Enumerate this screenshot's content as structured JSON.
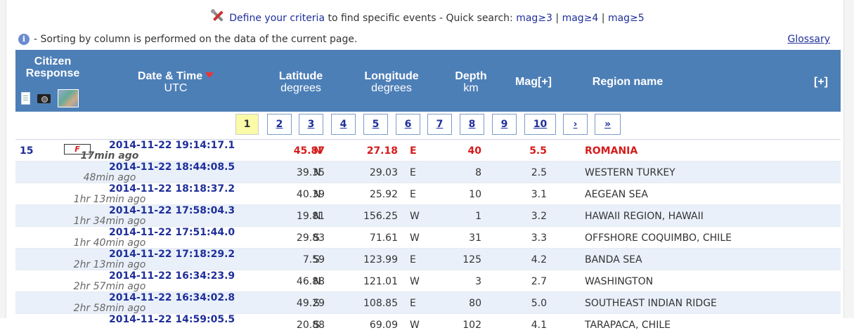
{
  "top": {
    "criteria_link": "Define your criteria",
    "criteria_text": " to find specific events - Quick search: ",
    "quick": [
      "mag≥3",
      "mag≥4",
      "mag≥5"
    ],
    "sep": " | "
  },
  "info": {
    "icon_glyph": "i",
    "text": "- Sorting by column is performed on the data of the current page.",
    "glossary": "Glossary"
  },
  "header": {
    "citizen_line1": "Citizen",
    "citizen_line2": "Response",
    "date_line1": "Date & Time",
    "date_line2": "UTC",
    "lat_line1": "Latitude",
    "lat_line2": "degrees",
    "lon_line1": "Longitude",
    "lon_line2": "degrees",
    "depth_line1": "Depth",
    "depth_line2": "km",
    "mag": "Mag[+]",
    "region": "Region name",
    "more": "[+]"
  },
  "pager": {
    "pages": [
      "1",
      "2",
      "3",
      "4",
      "5",
      "6",
      "7",
      "8",
      "9",
      "10"
    ],
    "next": "›",
    "last": "»",
    "current": "1"
  },
  "rows": [
    {
      "num": "15",
      "flag": "F",
      "date": "2014-11-22   19:14:17.1",
      "ago": "17min ago",
      "lat": "45.87",
      "lat_dir": "N",
      "lon": "27.18",
      "lon_dir": "E",
      "depth": "40",
      "mag": "5.5",
      "region": "ROMANIA",
      "highlight": true
    },
    {
      "num": "",
      "flag": "",
      "date": "2014-11-22   18:44:08.5",
      "ago": "48min ago",
      "lat": "39.35",
      "lat_dir": "N",
      "lon": "29.03",
      "lon_dir": "E",
      "depth": "8",
      "mag": "2.5",
      "region": "WESTERN TURKEY"
    },
    {
      "num": "",
      "flag": "",
      "date": "2014-11-22   18:18:37.2",
      "ago": "1hr 13min ago",
      "lat": "40.39",
      "lat_dir": "N",
      "lon": "25.92",
      "lon_dir": "E",
      "depth": "10",
      "mag": "3.1",
      "region": "AEGEAN SEA"
    },
    {
      "num": "",
      "flag": "",
      "date": "2014-11-22   17:58:04.3",
      "ago": "1hr 34min ago",
      "lat": "19.81",
      "lat_dir": "N",
      "lon": "156.25",
      "lon_dir": "W",
      "depth": "1",
      "mag": "3.2",
      "region": "HAWAII REGION, HAWAII"
    },
    {
      "num": "",
      "flag": "",
      "date": "2014-11-22   17:51:44.0",
      "ago": "1hr 40min ago",
      "lat": "29.83",
      "lat_dir": "S",
      "lon": "71.61",
      "lon_dir": "W",
      "depth": "31",
      "mag": "3.3",
      "region": "OFFSHORE COQUIMBO, CHILE"
    },
    {
      "num": "",
      "flag": "",
      "date": "2014-11-22   17:18:29.2",
      "ago": "2hr 13min ago",
      "lat": "7.59",
      "lat_dir": "S",
      "lon": "123.99",
      "lon_dir": "E",
      "depth": "125",
      "mag": "4.2",
      "region": "BANDA SEA"
    },
    {
      "num": "",
      "flag": "",
      "date": "2014-11-22   16:34:23.9",
      "ago": "2hr 57min ago",
      "lat": "46.88",
      "lat_dir": "N",
      "lon": "121.01",
      "lon_dir": "W",
      "depth": "3",
      "mag": "2.7",
      "region": "WASHINGTON"
    },
    {
      "num": "",
      "flag": "",
      "date": "2014-11-22   16:34:02.8",
      "ago": "2hr 58min ago",
      "lat": "49.29",
      "lat_dir": "S",
      "lon": "108.85",
      "lon_dir": "E",
      "depth": "80",
      "mag": "5.0",
      "region": "SOUTHEAST INDIAN RIDGE"
    },
    {
      "num": "",
      "flag": "",
      "date": "2014-11-22   14:59:05.5",
      "ago": "",
      "lat": "20.88",
      "lat_dir": "S",
      "lon": "69.09",
      "lon_dir": "W",
      "depth": "102",
      "mag": "4.1",
      "region": "TARAPACA, CHILE"
    }
  ],
  "colors": {
    "header_bg": "#4d7fb7",
    "link": "#1f2f9a",
    "highlight": "#d61c1c",
    "row_alt": "#e9f0fa",
    "pager_active": "#fafaa8"
  }
}
